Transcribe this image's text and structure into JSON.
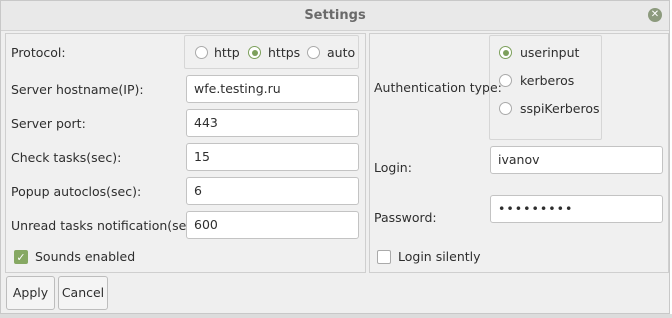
{
  "window": {
    "title": "Settings",
    "close_glyph": "✕"
  },
  "left": {
    "protocol_label": "Protocol:",
    "protocol_options": [
      "http",
      "https",
      "auto"
    ],
    "protocol_selected": "https",
    "server_hostname_label": "Server hostname(IP):",
    "server_hostname_value": "wfe.testing.ru",
    "server_port_label": "Server port:",
    "server_port_value": "443",
    "check_tasks_label": "Check tasks(sec):",
    "check_tasks_value": "15",
    "popup_autoclose_label": "Popup autoclos(sec):",
    "popup_autoclose_value": "6",
    "unread_notification_label": "Unread tasks notification(sec):",
    "unread_notification_value": "600",
    "sounds_enabled_label": "Sounds enabled",
    "sounds_enabled_checked": true
  },
  "right": {
    "auth_type_label": "Authentication type:",
    "auth_options": [
      "userinput",
      "kerberos",
      "sspiKerberos"
    ],
    "auth_selected": "userinput",
    "login_label": "Login:",
    "login_value": "ivanov",
    "password_label": "Password:",
    "password_value": "•••••••••",
    "login_silently_label": "Login silently",
    "login_silently_checked": false
  },
  "buttons": {
    "apply_label": "Apply",
    "cancel_label": "Cancel"
  },
  "colors": {
    "accent": "#7da05c",
    "background": "#efefef"
  },
  "icons": {
    "close": "close-icon",
    "check": "checkmark-icon"
  }
}
